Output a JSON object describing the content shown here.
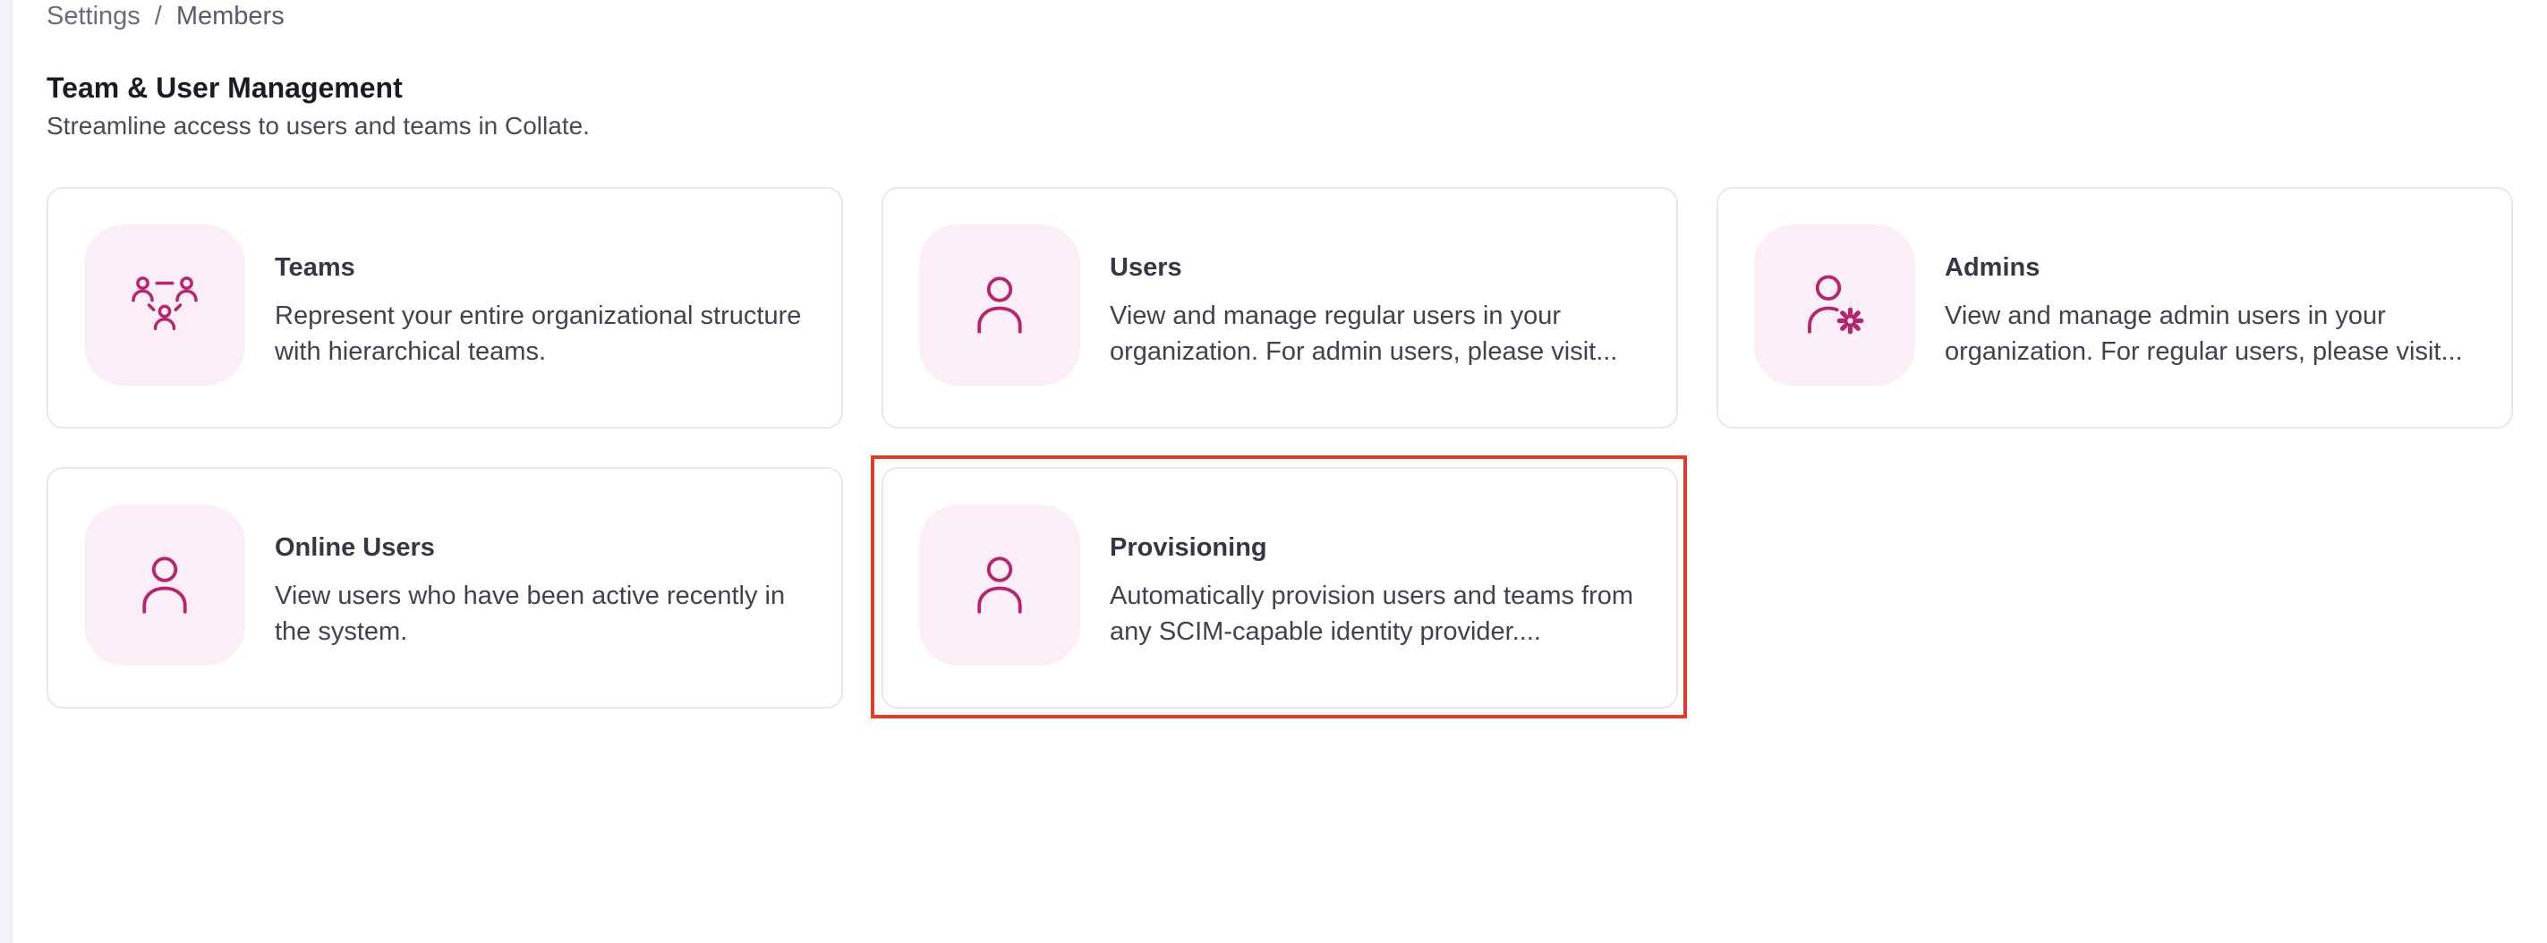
{
  "breadcrumb": {
    "items": [
      "Settings",
      "Members"
    ],
    "separator": "/"
  },
  "header": {
    "title": "Team & User Management",
    "subtitle": "Streamline access to users and teams in Collate."
  },
  "colors": {
    "accent": "#b3276f",
    "icon_bg": "#fbeef7",
    "highlight": "#e33b26"
  },
  "cards": [
    {
      "title": "Teams",
      "description": "Represent your entire organizational structure with hierarchical teams.",
      "icon": "teams-icon"
    },
    {
      "title": "Users",
      "description": "View and manage regular users in your organization. For admin users, please visit...",
      "icon": "user-icon"
    },
    {
      "title": "Admins",
      "description": "View and manage admin users in your organization. For regular users, please visit...",
      "icon": "admin-user-gear-icon"
    },
    {
      "title": "Online Users",
      "description": "View users who have been active recently in the system.",
      "icon": "user-icon"
    },
    {
      "title": "Provisioning",
      "description": "Automatically provision users and teams from any SCIM-capable identity provider....",
      "icon": "user-icon"
    }
  ]
}
